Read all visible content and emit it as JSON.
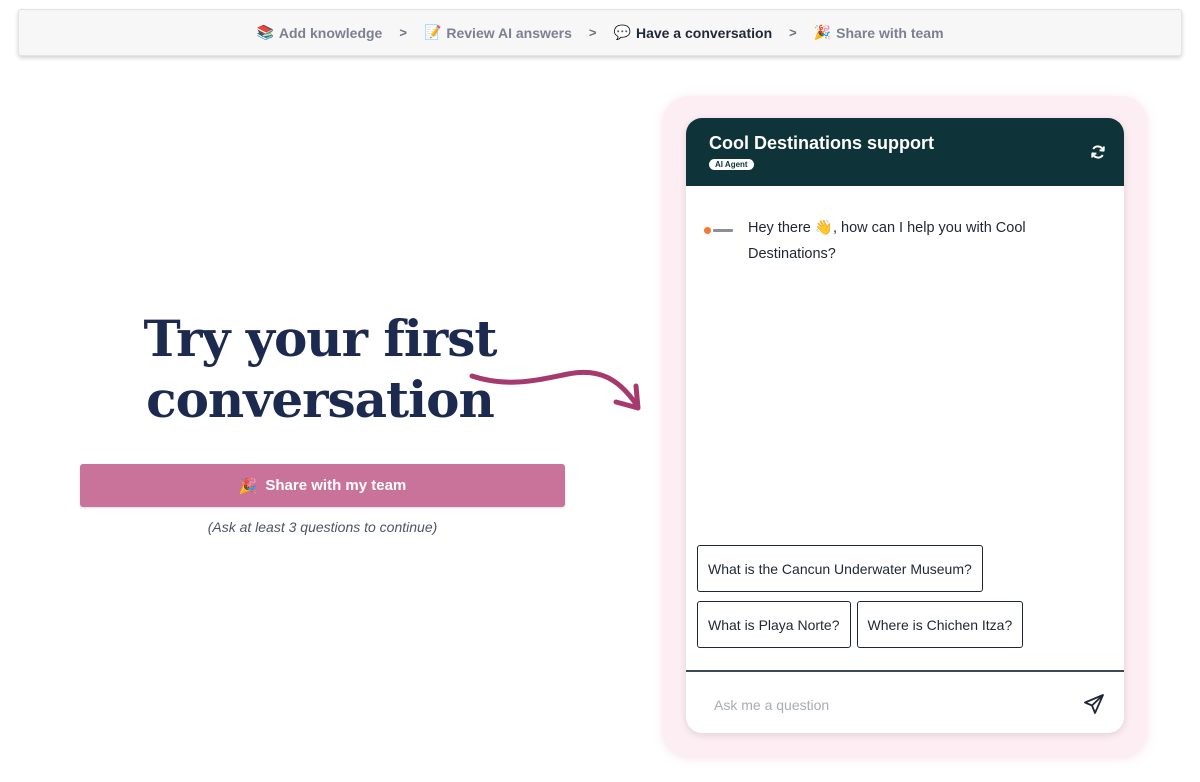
{
  "stepper": {
    "steps": [
      {
        "emoji": "📚",
        "label": "Add knowledge"
      },
      {
        "emoji": "📝",
        "label": "Review AI answers"
      },
      {
        "emoji": "💬",
        "label": "Have a conversation"
      },
      {
        "emoji": "🎉",
        "label": "Share with team"
      }
    ],
    "separator": ">",
    "active_index": 2
  },
  "hero": {
    "title": "Try your first conversation",
    "share_button": {
      "emoji": "🎉",
      "label": "Share with my team"
    },
    "hint": "(Ask at least 3 questions to continue)"
  },
  "chat": {
    "title": "Cool Destinations support",
    "badge": "AI Agent",
    "message": {
      "before": "Hey there ",
      "emoji": "👋",
      "after": ", how can I help you with Cool Destinations?"
    },
    "suggestions": [
      "What is the Cancun Underwater Museum?",
      "What is Playa Norte?",
      "Where is Chichen Itza?"
    ],
    "input_placeholder": "Ask me a question",
    "input_value": ""
  },
  "colors": {
    "header_bg": "#0e3338",
    "share_button_bg": "#c9739b",
    "arrow": "#a63a6e",
    "frame_bg": "#fdeef3",
    "title_text": "#1b2a4e"
  },
  "icons": [
    "books-emoji",
    "memo-emoji",
    "speech-bubble-emoji",
    "party-popper-emoji",
    "refresh-icon",
    "send-icon",
    "curved-arrow-icon",
    "company-logo"
  ]
}
